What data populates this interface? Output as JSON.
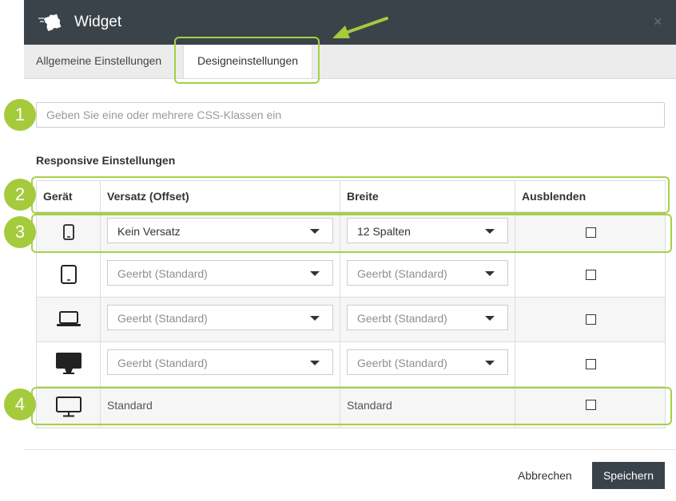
{
  "window": {
    "title": "Widget",
    "close_glyph": "×"
  },
  "tabs": [
    {
      "label": "Allgemeine Einstellungen",
      "active": false
    },
    {
      "label": "Designeinstellungen",
      "active": true
    }
  ],
  "css_input": {
    "value": "",
    "placeholder": "Geben Sie eine oder mehrere CSS-Klassen ein"
  },
  "responsive": {
    "section_label": "Responsive Einstellungen",
    "columns": [
      "Gerät",
      "Versatz (Offset)",
      "Breite",
      "Ausblenden"
    ],
    "rows": [
      {
        "device_icon": "smartphone-icon",
        "offset": "Kein Versatz",
        "width": "12 Spalten",
        "hide": false
      },
      {
        "device_icon": "tablet-icon",
        "offset": "Geerbt (Standard)",
        "width": "Geerbt (Standard)",
        "hide": false
      },
      {
        "device_icon": "laptop-icon",
        "offset": "Geerbt (Standard)",
        "width": "Geerbt (Standard)",
        "hide": false
      },
      {
        "device_icon": "large-desktop-icon",
        "offset": "Geerbt (Standard)",
        "width": "Geerbt (Standard)",
        "hide": false
      },
      {
        "device_icon": "desktop-monitor-icon",
        "offset": "Standard",
        "width": "Standard",
        "hide": false
      }
    ]
  },
  "annotations": [
    "1",
    "2",
    "3",
    "4"
  ],
  "footer": {
    "cancel_label": "Abbrechen",
    "save_label": "Speichern"
  },
  "colors": {
    "header_bg": "#3b434a",
    "accent_green": "#a4cb3c",
    "save_button_bg": "#3b434a"
  }
}
